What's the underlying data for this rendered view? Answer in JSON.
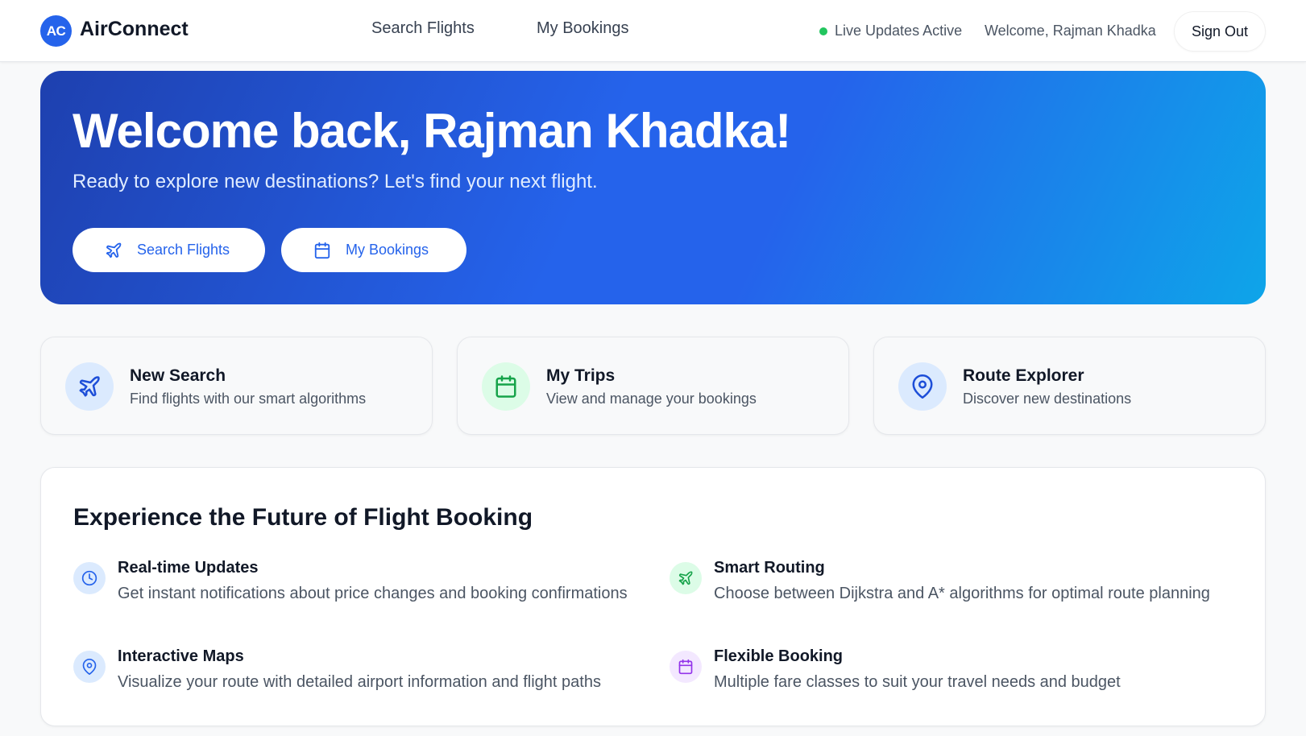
{
  "header": {
    "logo_badge": "AC",
    "brand": "AirConnect",
    "nav": [
      "Search Flights",
      "My Bookings"
    ],
    "live_status": "Live Updates Active",
    "welcome": "Welcome, Rajman Khadka",
    "signout": "Sign Out"
  },
  "hero": {
    "title": "Welcome back, Rajman Khadka!",
    "subtitle": "Ready to explore new destinations? Let's find your next flight.",
    "search_button": "Search Flights",
    "bookings_button": "My Bookings"
  },
  "cards": [
    {
      "title": "New Search",
      "desc": "Find flights with our smart algorithms",
      "icon": "plane-icon"
    },
    {
      "title": "My Trips",
      "desc": "View and manage your bookings",
      "icon": "calendar-icon"
    },
    {
      "title": "Route Explorer",
      "desc": "Discover new destinations",
      "icon": "map-pin-icon"
    }
  ],
  "features": {
    "title": "Experience the Future of Flight Booking",
    "items": [
      {
        "title": "Real-time Updates",
        "desc": "Get instant notifications about price changes and booking confirmations",
        "icon": "clock-icon"
      },
      {
        "title": "Smart Routing",
        "desc": "Choose between Dijkstra and A* algorithms for optimal route planning",
        "icon": "plane-icon"
      },
      {
        "title": "Interactive Maps",
        "desc": "Visualize your route with detailed airport information and flight paths",
        "icon": "map-pin-icon"
      },
      {
        "title": "Flexible Booking",
        "desc": "Multiple fare classes to suit your travel needs and budget",
        "icon": "calendar-icon"
      }
    ]
  },
  "colors": {
    "primary": "#2563eb",
    "live": "#22c55e",
    "hero_gradient_start": "#1e40af",
    "hero_gradient_end": "#0ea5e9"
  }
}
